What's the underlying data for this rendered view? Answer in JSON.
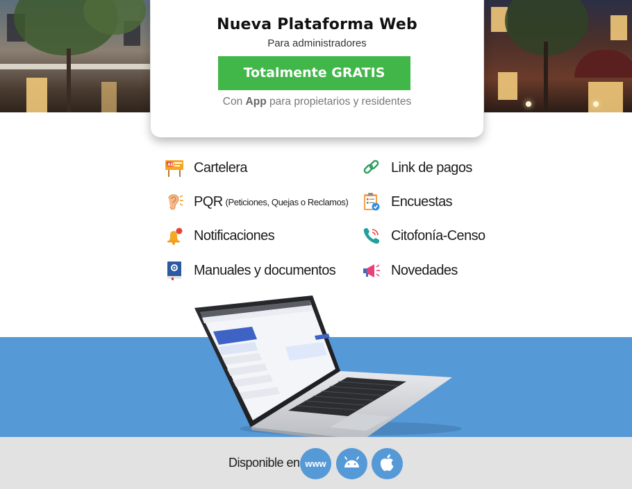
{
  "card": {
    "title": "Nueva Plataforma Web",
    "subtitle": "Para administradores",
    "cta_label": "Totalmente GRATIS",
    "footer_pre": "Con",
    "footer_app": "App",
    "footer_post": "para propietarios y residentes"
  },
  "features": {
    "left": [
      {
        "label": "Cartelera",
        "icon": "billboard-icon"
      },
      {
        "label": "PQR",
        "sublabel": "(Peticiones, Quejas o Reclamos)",
        "icon": "ear-icon"
      },
      {
        "label": "Notificaciones",
        "icon": "bell-icon"
      },
      {
        "label": "Manuales y documentos",
        "icon": "manual-icon"
      }
    ],
    "right": [
      {
        "label": "Link de pagos",
        "icon": "link-icon"
      },
      {
        "label": "Encuestas",
        "icon": "survey-clipboard-icon"
      },
      {
        "label": "Citofonía-Censo",
        "icon": "phone-icon"
      },
      {
        "label": "Novedades",
        "icon": "megaphone-icon"
      }
    ]
  },
  "availability": {
    "label": "Disponible en",
    "web_label": "www",
    "platforms": [
      "web",
      "android",
      "apple"
    ]
  },
  "colors": {
    "accent_green": "#41b649",
    "band_blue": "#5699d7",
    "footer_gray": "#e2e2e2"
  }
}
